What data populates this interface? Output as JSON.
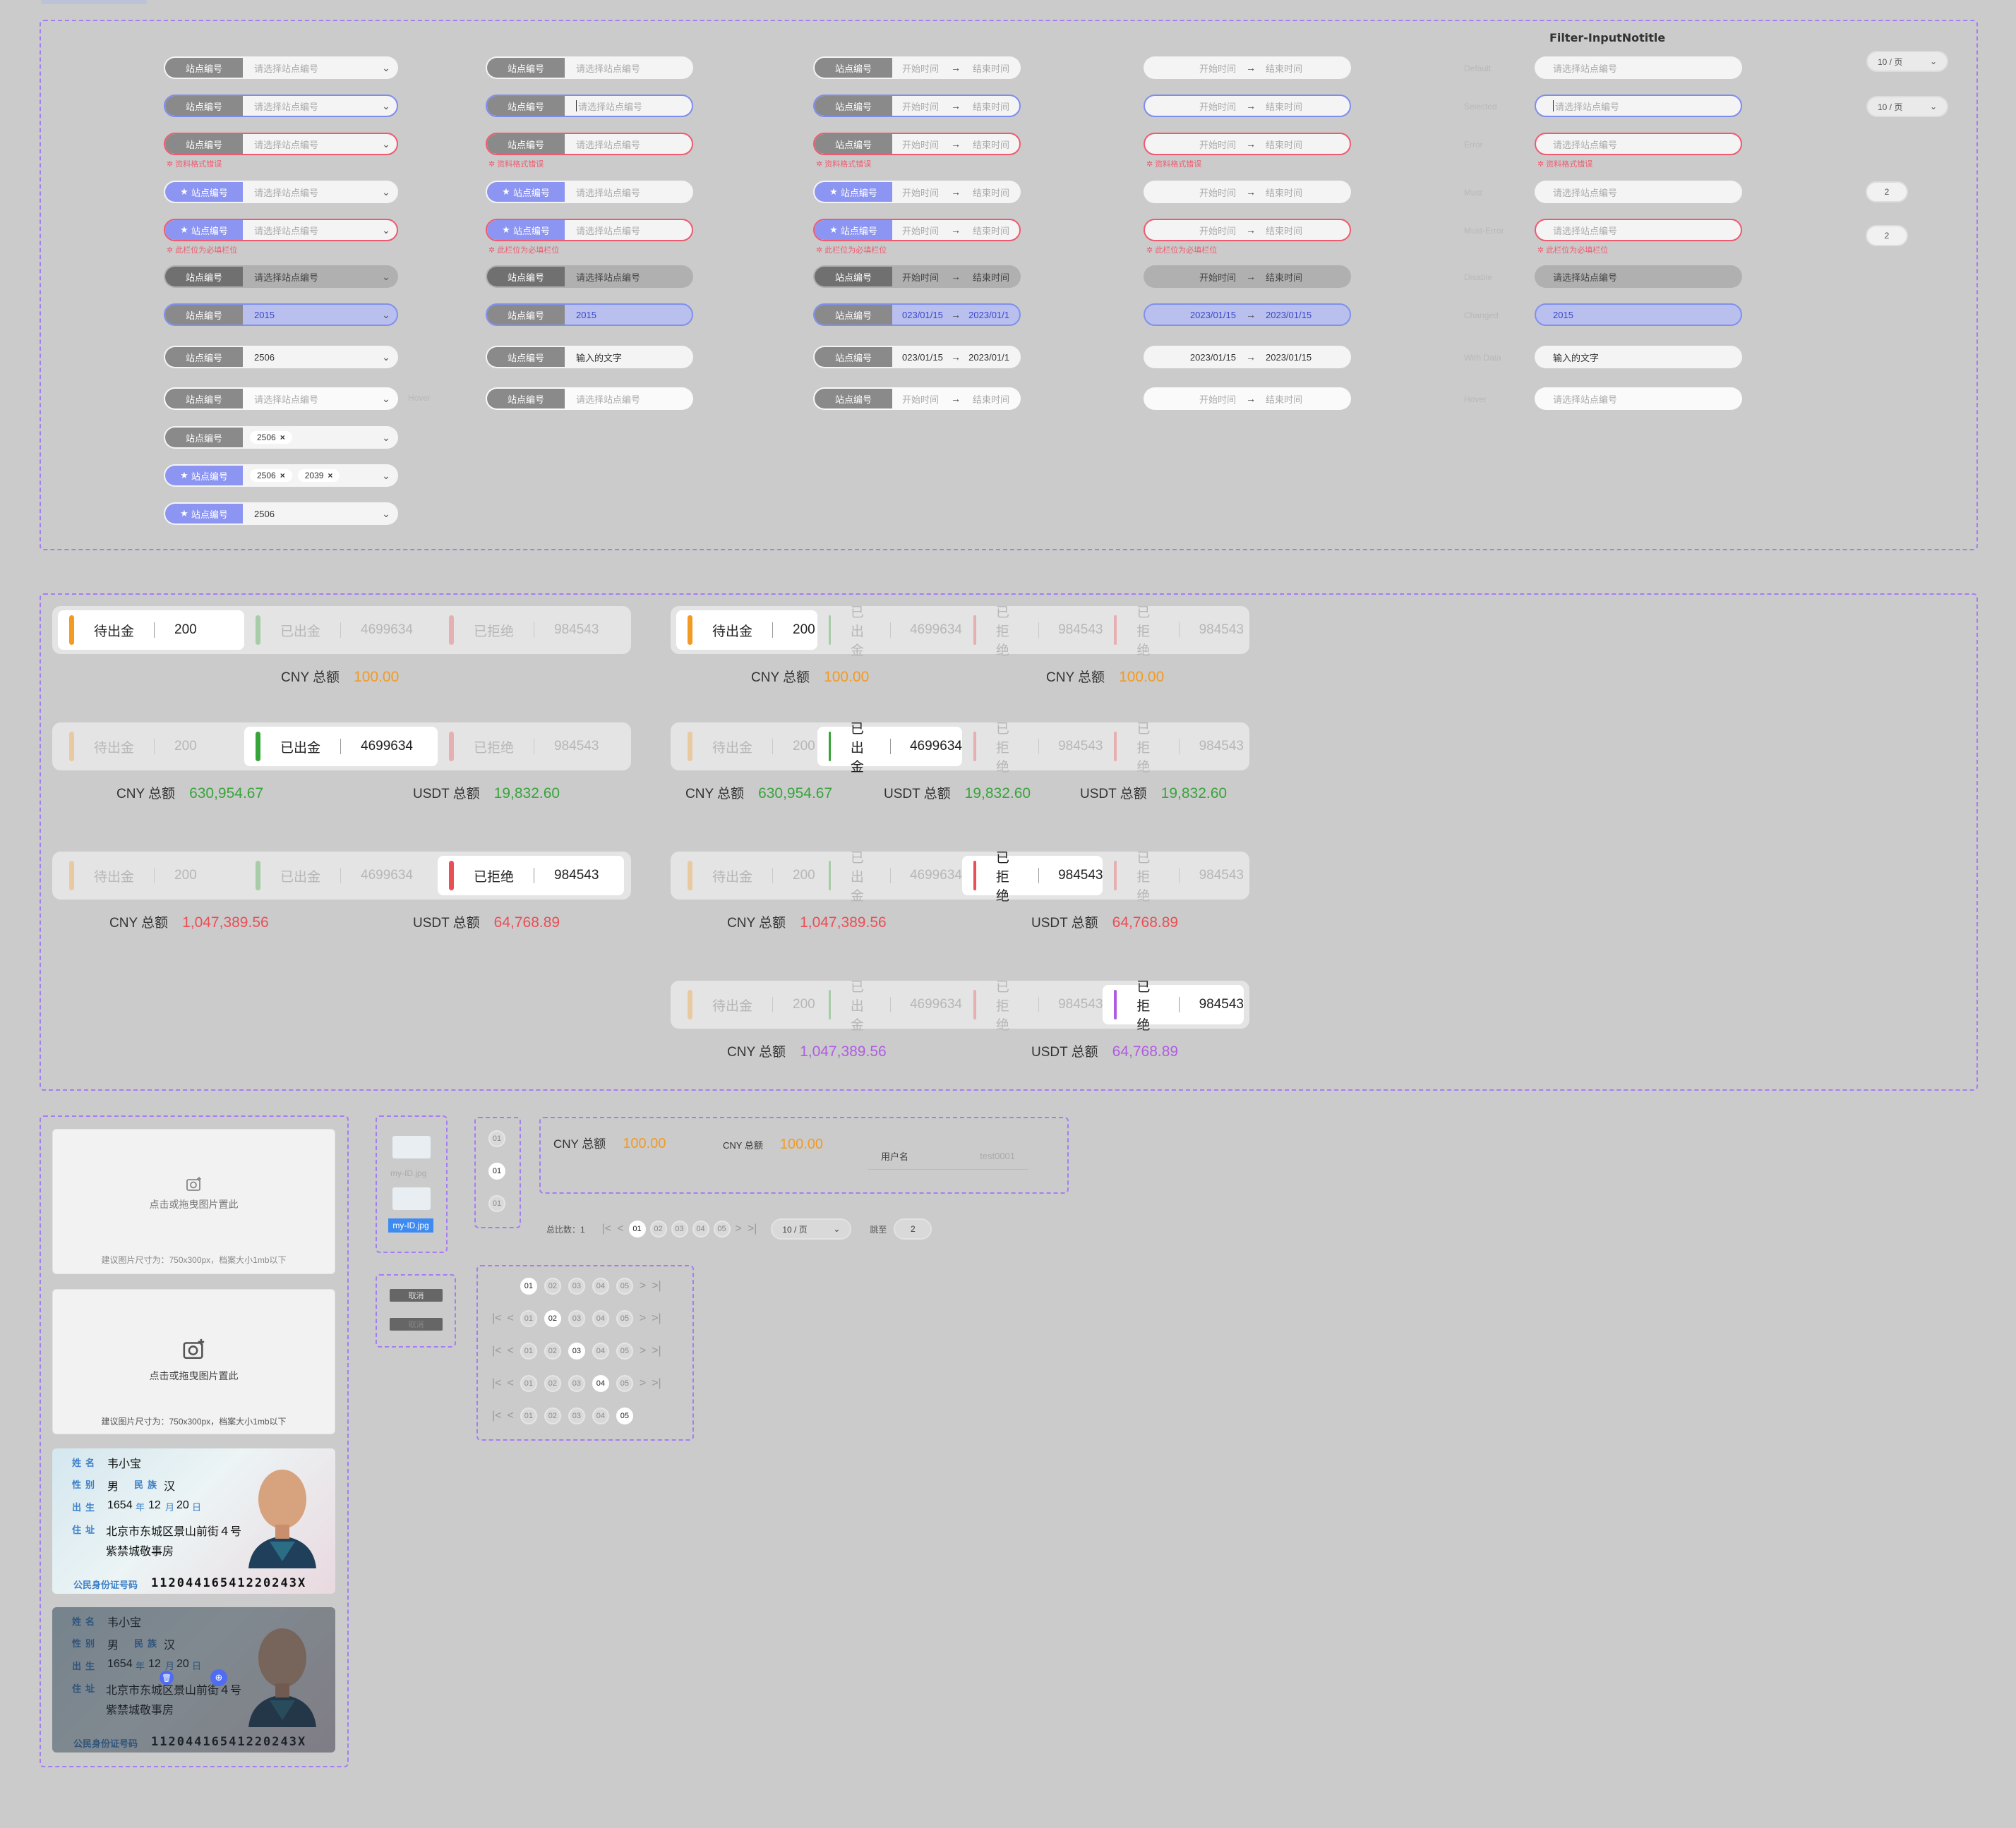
{
  "filter_title": "Filter-InputNotitle",
  "label": "站点编号",
  "placeholder": "请选择站点编号",
  "placeholder_input": "请选择站点编号",
  "date_start": "开始时间",
  "date_end": "结束时间",
  "arrow": "→",
  "error_format": "✲ 资料格式错误",
  "error_required": "✲ 此栏位为必填栏位",
  "val_2015": "2015",
  "val_2506": "2506",
  "val_2039": "2039",
  "val_text": "输入的文字",
  "val_date": "2023/01/15",
  "val_date_clip_left": "023/01/15",
  "val_date_clip_right": "2023/01/1",
  "hover_note": "Hover",
  "state_labels": {
    "default": "Default",
    "selected": "Selected",
    "error": "Error",
    "must": "Must",
    "must_error": "Must-Error",
    "disable": "Disable",
    "changed": "Changed",
    "with_data": "With Data",
    "hover": "Hover"
  },
  "page_size": "10 / 页",
  "page_num": "2",
  "tabs": {
    "pending": "待出金",
    "pending_val": "200",
    "done": "已出金",
    "done_val": "4699634",
    "rejected": "已拒绝",
    "rejected_val": "984543"
  },
  "sums": {
    "cny": "CNY 总额",
    "usdt": "USDT 总额",
    "v_orange": "100.00",
    "v_green_cny": "630,954.67",
    "v_green_usdt": "19,832.60",
    "v_red_cny": "1,047,389.56",
    "v_red_usdt": "64,768.89"
  },
  "colors": {
    "orange": "#f39a22",
    "green": "#37a43a",
    "red": "#ea4e56",
    "purple": "#b05ce2",
    "accent": "#7e8cf0"
  },
  "upload": {
    "hint": "点击或拖曳图片置此",
    "spec": "建议图片尺寸为：750x300px，档案大小1mb以下",
    "icon": "camera-add-icon"
  },
  "idcard": {
    "name_k": "姓名",
    "name_v": "韦小宝",
    "sex_k": "性别",
    "sex_v": "男",
    "nation_k": "民族",
    "nation_v": "汉",
    "birth_k": "出生",
    "birth_y": "1654",
    "birth_y_u": "年",
    "birth_m": "12",
    "birth_m_u": "月",
    "birth_d": "20",
    "birth_d_u": "日",
    "addr_k": "住址",
    "addr_1": "北京市东城区景山前街４号",
    "addr_2": "紫禁城敬事房",
    "idno_k": "公民身份证号码",
    "idno": "11204416541220243X"
  },
  "file": {
    "name": "my-ID.jpg"
  },
  "buttons": {
    "cancel": "取消",
    "cancel2": "取消"
  },
  "mini": {
    "cny": "CNY 总额",
    "val": "100.00",
    "user_label": "用户名",
    "user_ph": "test0001"
  },
  "pager": {
    "total": "总比数：1",
    "jump": "跳至",
    "pages": [
      "01",
      "02",
      "03",
      "04",
      "05"
    ]
  },
  "stepper": [
    "01",
    "01",
    "01"
  ]
}
